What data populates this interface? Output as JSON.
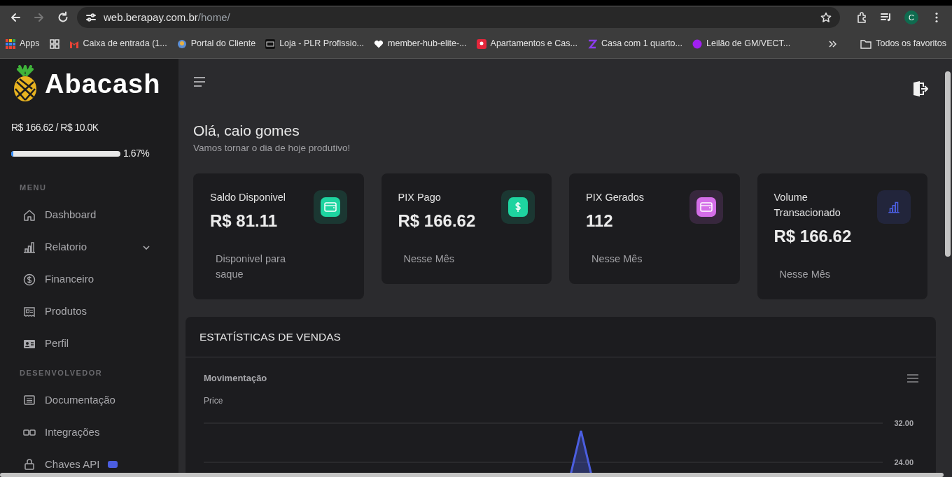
{
  "browser": {
    "address_bar": {
      "host": "web.berapay.com.br",
      "path": "/home/"
    },
    "forward_disabled": true,
    "profile_initial": "C",
    "bookmarks": [
      {
        "label": "Apps"
      },
      {
        "label": "Caixa de entrada (1..."
      },
      {
        "label": "Portal do Cliente"
      },
      {
        "label": "Loja - PLR Profissio..."
      },
      {
        "label": "member-hub-elite-..."
      },
      {
        "label": "Apartamentos e Cas..."
      },
      {
        "label": "Casa com 1 quarto..."
      },
      {
        "label": "Leilão de GM/VECT..."
      }
    ],
    "all_bookmarks": "Todos os favoritos"
  },
  "sidebar": {
    "brand": "Abacash",
    "usage": {
      "text": "R$ 166.62 / R$ 10.0K",
      "level": 0.0167,
      "percent": "1.67%"
    },
    "sections": [
      {
        "title": "MENU",
        "items": [
          {
            "label": "Dashboard",
            "expandable": false,
            "badge": false
          },
          {
            "label": "Relatorio",
            "expandable": true,
            "badge": false
          },
          {
            "label": "Financeiro",
            "expandable": false,
            "badge": false
          },
          {
            "label": "Produtos",
            "expandable": false,
            "badge": false
          },
          {
            "label": "Perfil",
            "expandable": false,
            "badge": false
          }
        ]
      },
      {
        "title": "DESENVOLVEDOR",
        "items": [
          {
            "label": "Documentação",
            "expandable": false,
            "badge": false
          },
          {
            "label": "Integrações",
            "expandable": false,
            "badge": false
          },
          {
            "label": "Chaves API",
            "expandable": false,
            "badge": true
          }
        ]
      }
    ]
  },
  "greeting": {
    "title": "Olá, caio gomes",
    "subtitle": "Vamos tornar o dia de hoje produtivo!"
  },
  "stats": [
    {
      "label": "Saldo Disponivel",
      "value": "R$ 81.11",
      "note": "Disponivel para saque",
      "color": "#1ed4a0"
    },
    {
      "label": "PIX Pago",
      "value": "R$ 166.62",
      "note": "Nesse Mês",
      "color": "#1ed4a0"
    },
    {
      "label": "PIX Gerados",
      "value": "112",
      "note": "Nesse Mês",
      "color": "#d46ee8"
    },
    {
      "label": "Volume Transacionado",
      "value": "R$ 166.62",
      "note": "Nesse Mês",
      "color": "#4b5ee0"
    }
  ],
  "sales_panel": {
    "title": "ESTATÍSTICAS DE VENDAS",
    "chart": {
      "title": "Movimentação",
      "axis_label": "Price",
      "tick_labels": [
        "32.00",
        "24.00"
      ]
    }
  }
}
